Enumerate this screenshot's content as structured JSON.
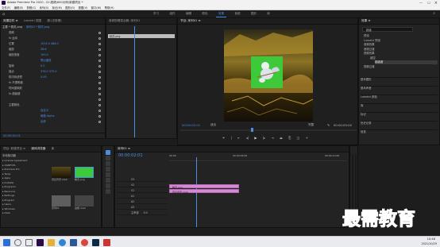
{
  "app": {
    "title": "Adobe Premiere Pro 2020 - D:\\视频\\600示例\\新建项目 *",
    "menu": [
      "文件(F)",
      "编辑(E)",
      "剪辑(C)",
      "序列(S)",
      "标记(M)",
      "图形(G)",
      "视图(V)",
      "窗口(W)",
      "帮助(H)"
    ],
    "workspaces": [
      "学习",
      "组件",
      "编辑",
      "颜色",
      "效果",
      "音频",
      "图形",
      "库"
    ],
    "active_workspace": "效果"
  },
  "effect_controls": {
    "tabs": [
      "效果控件 ≡",
      "Lumetri 范围",
      "源:(无剪辑)",
      "音频剪辑混合器: 序列01"
    ],
    "master": "主要 * 精灵.png",
    "clip": "序列01 * 精灵.png",
    "rows": [
      {
        "label": "视频",
        "value": ""
      },
      {
        "label": "fx 运动",
        "value": ""
      },
      {
        "label": "位置",
        "value": "1024.0   486.0"
      },
      {
        "label": "缩放",
        "value": "28.6"
      },
      {
        "label": "缩放宽度",
        "value": "100.0"
      },
      {
        "label": "",
        "value": "等比缩放"
      },
      {
        "label": "旋转",
        "value": "0.0"
      },
      {
        "label": "锚点",
        "value": "376.0   375.0"
      },
      {
        "label": "防闪烁滤镜",
        "value": "0.00"
      },
      {
        "label": "fx 不透明度",
        "value": ""
      },
      {
        "label": "时间重映射",
        "value": ""
      },
      {
        "label": "fx 超级键",
        "value": ""
      },
      {
        "label": "",
        "value": ""
      },
      {
        "label": "主要颜色",
        "value": ""
      },
      {
        "label": "",
        "value": "自定义"
      },
      {
        "label": "",
        "value": "阈值 Alpha"
      },
      {
        "label": "",
        "value": "反转"
      }
    ],
    "timecode": "00:00:02:01"
  },
  "mini_timeline": {
    "label": "精灵.png"
  },
  "program_monitor": {
    "tab": "节目: 序列01 ≡",
    "timecode_left": "00:00:02:01",
    "fit": "适合",
    "quality": "完整",
    "timecode_right": "00:00:05:00"
  },
  "effects_panel": {
    "title": "效果 ≡",
    "search_placeholder": "超级",
    "tree": [
      "预设",
      "Lumetri 预设",
      "音频效果",
      "音频过渡",
      "视频效果",
      "键控",
      "超级键",
      "视频过渡"
    ],
    "bottom_items": [
      "基本图形",
      "基本声音",
      "Lumetri 颜色",
      "库",
      "标记",
      "历史记录",
      "信息"
    ]
  },
  "project_panel": {
    "tabs": [
      "项目: 新建项目 ≡",
      "媒体浏览器",
      "库"
    ],
    "path_label": "本地驱动器",
    "folders": [
      "License Agreement",
      "OGNFCPL",
      "Premiere Pro",
      "Temp",
      "Apps",
      "Installer",
      "Programs",
      "Resource",
      "PerfLogs",
      "Program",
      "Users",
      "Windows",
      "Data"
    ],
    "items": [
      {
        "name": "霓虹背景.mp4",
        "duration": "5:00"
      },
      {
        "name": "精灵.png",
        "duration": "5:00"
      },
      {
        "name": "序列01",
        "duration": "5:00"
      },
      {
        "name": "边框.mp4",
        "duration": "5:00"
      },
      {
        "name": "边框.jpg",
        "duration": "5:00"
      }
    ]
  },
  "timeline": {
    "tab": "序列01 ≡",
    "timecode": "00:00:02:01",
    "ruler": [
      "00:00",
      "00:00:05:00",
      "00:00:10:00"
    ],
    "tracks": [
      "V3",
      "V2",
      "V1",
      "A1",
      "A2",
      "A3",
      "主声道"
    ],
    "master_value": "0.0",
    "clips": [
      {
        "name": "精灵.png",
        "track": "V2"
      },
      {
        "name": "霓虹背景.mp4",
        "track": "V1"
      }
    ]
  },
  "watermark": "最需教育",
  "taskbar": {
    "time": "10:46",
    "date": "2021/10/29"
  },
  "colors": {
    "accent": "#2d8ceb",
    "clip": "#d889d6",
    "green": "#3ec93a",
    "watermark": "#1c2c9c"
  }
}
